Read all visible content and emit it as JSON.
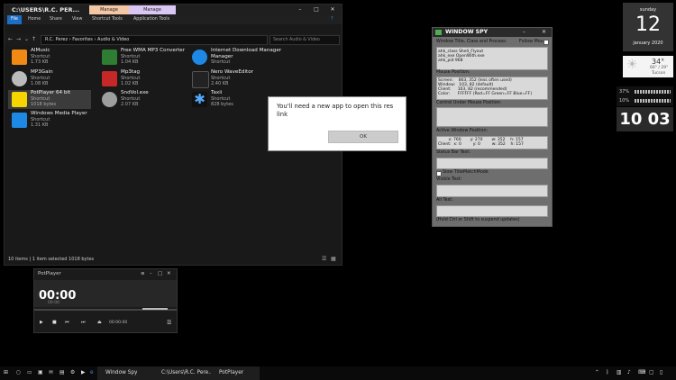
{
  "explorer": {
    "path": "C:\\USERS\\R.C. PER...",
    "ctx_tabs": [
      "Manage",
      "Manage"
    ],
    "ribbon_tabs": [
      "File",
      "Home",
      "Share",
      "View",
      "Shortcut Tools",
      "Application Tools"
    ],
    "breadcrumbs": "R.C. Perez  ›  Favorites  ›  Audio & Video",
    "search_placeholder": "Search Audio & Video",
    "status": "10 items   |   1 item selected   1018 bytes",
    "files": [
      {
        "name": "AIMusic",
        "type": "Shortcut",
        "size": "1.73 KB"
      },
      {
        "name": "MP3Gain",
        "type": "Shortcut",
        "size": "1.08 KB"
      },
      {
        "name": "PotPlayer 64 bit",
        "type": "Shortcut",
        "size": "1018 bytes"
      },
      {
        "name": "Windows Media Player",
        "type": "Shortcut",
        "size": "1.31 KB"
      },
      {
        "name": "Free WMA MP3 Converter",
        "type": "Shortcut",
        "size": "1.04 KB"
      },
      {
        "name": "Mp3tag",
        "type": "Shortcut",
        "size": "1.02 KB"
      },
      {
        "name": "SndVol.exe",
        "type": "Shortcut",
        "size": "2.07 KB"
      },
      {
        "name": "Internet Download Manager",
        "type": "Shortcut",
        "size": ""
      },
      {
        "name": "Nero WaveEditor",
        "type": "Shortcut",
        "size": "2.40 KB"
      },
      {
        "name": "Taxii",
        "type": "Shortcut",
        "size": "828 bytes"
      }
    ]
  },
  "dialog": {
    "message": "You'll need a new app to open this res link",
    "ok_label": "OK"
  },
  "spy": {
    "title": "WINDOW SPY",
    "title_label": "Window Title, Class and Process:",
    "follow_mouse": "Follow Mouse",
    "title_box": "ahk_class Shell_Flyout\nahk_exe OpenWith.exe\nahk_pid 968",
    "mouse_label": "Mouse Position:",
    "mouse_box": "Screen:    863, 352 (less often used)\nWindow:   103, 82 (default)\nClient:     103, 82 (recommended)\nColor:      FFFFFF (Red=FF Green=FF Blue=FF)",
    "control_label": "Control Under Mouse Position:",
    "active_label": "Active Window Position:",
    "active_box": "        x: 760       y: 270       w: 352    h: 157\nClient:  x: 0         y: 0         w: 352    h: 157",
    "statusbar_label": "Status Bar Text:",
    "slow_label": "Slow TitleMatchMode",
    "visible_label": "Visible Text:",
    "all_label": "All Text:",
    "footer": "(Hold Ctrl or Shift to suspend updates)"
  },
  "potplayer": {
    "title": "PotPlayer",
    "time": "00:00",
    "time_sub": "00:00",
    "position": "00:00:00"
  },
  "gadgets": {
    "weekday": "sunday",
    "day": "12",
    "month_year": "january 2020",
    "temp": "34°",
    "range": "66° / 29°",
    "city": "Tucson",
    "cpu": "37%",
    "ram": "10%",
    "clock": "10 03"
  },
  "taskbar": {
    "items": [
      "Window Spy",
      "C:\\Users\\R.C. Pere...",
      "PotPlayer"
    ]
  }
}
